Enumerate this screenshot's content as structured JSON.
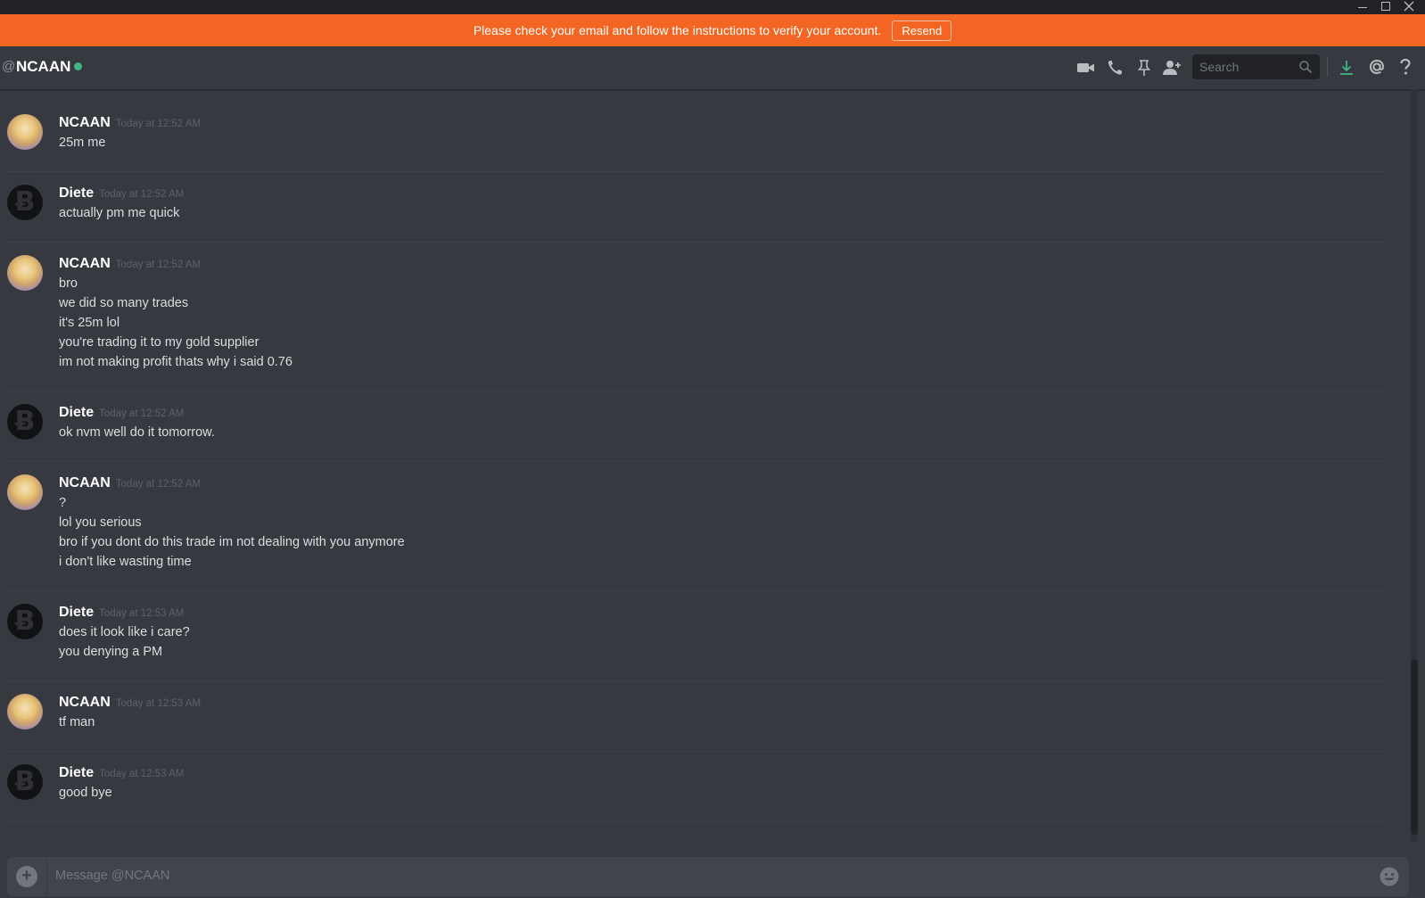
{
  "notice": {
    "text": "Please check your email and follow the instructions to verify your account.",
    "button_label": "Resend"
  },
  "header": {
    "at_symbol": "@",
    "channel_name": "NCAAN",
    "search_placeholder": "Search"
  },
  "messages": [
    {
      "author": "NCAAN",
      "time": "Today at 12:52 AM",
      "avatar": "ncaan",
      "lines": [
        "25m me"
      ]
    },
    {
      "author": "Diete",
      "time": "Today at 12:52 AM",
      "avatar": "diete",
      "lines": [
        "actually pm me quick"
      ]
    },
    {
      "author": "NCAAN",
      "time": "Today at 12:52 AM",
      "avatar": "ncaan",
      "lines": [
        "bro",
        "we did so many trades",
        "it's 25m lol",
        "you're trading it to my gold supplier",
        "im not making profit thats why i said 0.76"
      ]
    },
    {
      "author": "Diete",
      "time": "Today at 12:52 AM",
      "avatar": "diete",
      "lines": [
        "ok nvm well do it tomorrow."
      ]
    },
    {
      "author": "NCAAN",
      "time": "Today at 12:52 AM",
      "avatar": "ncaan",
      "lines": [
        "?",
        "lol you serious",
        "bro if you dont do this trade im not dealing with you anymore",
        "i don't like wasting time"
      ]
    },
    {
      "author": "Diete",
      "time": "Today at 12:53 AM",
      "avatar": "diete",
      "lines": [
        "does it look like i care?",
        "you denying a PM"
      ]
    },
    {
      "author": "NCAAN",
      "time": "Today at 12:53 AM",
      "avatar": "ncaan",
      "lines": [
        "tf man"
      ]
    },
    {
      "author": "Diete",
      "time": "Today at 12:53 AM",
      "avatar": "diete",
      "lines": [
        "good bye"
      ]
    }
  ],
  "composer": {
    "placeholder": "Message @NCAAN"
  },
  "colors": {
    "notice_bg": "#f26522",
    "online": "#43b581",
    "background": "#36393f"
  },
  "icons": [
    "video-call-icon",
    "voice-call-icon",
    "pin-icon",
    "add-friend-icon",
    "search-icon",
    "download-icon",
    "mention-icon",
    "help-icon",
    "attach-icon",
    "emoji-icon"
  ]
}
